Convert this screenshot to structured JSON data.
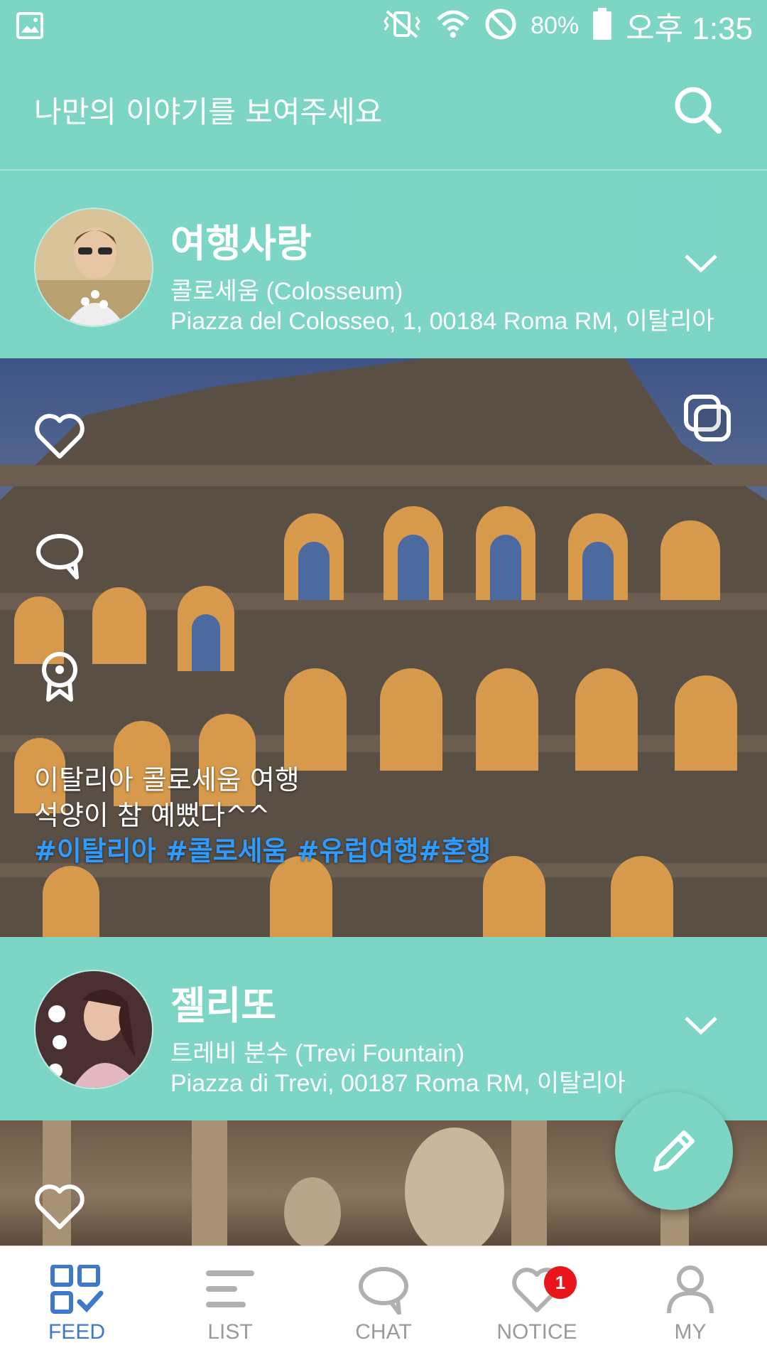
{
  "status_bar": {
    "battery": "80%",
    "time": "오후 1:35"
  },
  "search": {
    "placeholder": "나만의 이야기를 보여주세요"
  },
  "posts": [
    {
      "username": "여행사랑",
      "place": "콜로세움 (Colosseum)",
      "address": "Piazza del Colosseo, 1, 00184 Roma RM, 이탈리아",
      "caption_lines": [
        "이탈리아 콜로세움 여행",
        "석양이 참 예뻤다^^"
      ],
      "hashtags": "#이탈리아 #콜로세움 #유럽여행#혼행"
    },
    {
      "username": "젤리또",
      "place": "트레비 분수 (Trevi Fountain)",
      "address": "Piazza di Trevi, 00187 Roma RM, 이탈리아"
    }
  ],
  "nav": {
    "items": [
      {
        "label": "FEED"
      },
      {
        "label": "LIST"
      },
      {
        "label": "CHAT"
      },
      {
        "label": "NOTICE",
        "badge": "1"
      },
      {
        "label": "MY"
      }
    ]
  },
  "colors": {
    "accent": "#7dd6c4",
    "active_nav": "#3d78c9",
    "hashtag": "#2e9bff",
    "badge": "#e8151b"
  }
}
